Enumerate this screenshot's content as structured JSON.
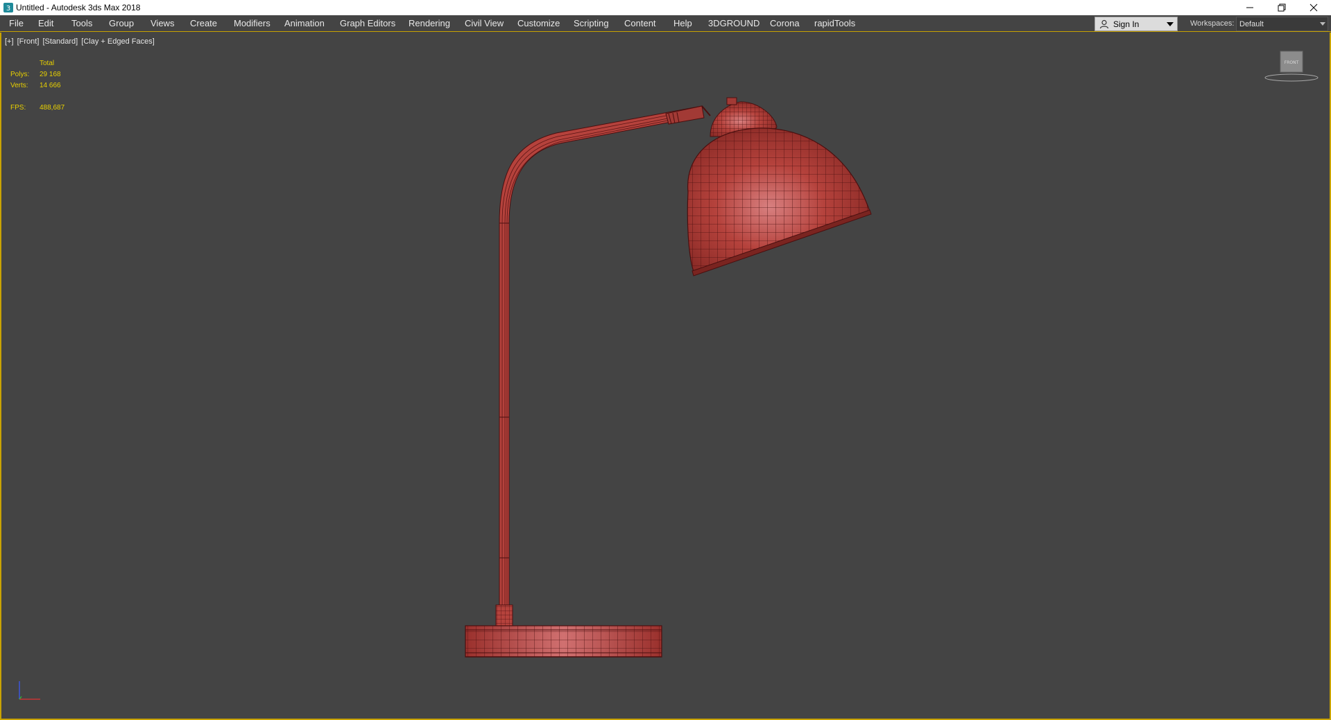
{
  "window": {
    "title": "Untitled - Autodesk 3ds Max 2018",
    "app_icon": "3dsmax-icon"
  },
  "menu": {
    "items": [
      {
        "label": "File"
      },
      {
        "label": "Edit"
      },
      {
        "label": "Tools"
      },
      {
        "label": "Group"
      },
      {
        "label": "Views"
      },
      {
        "label": "Create"
      },
      {
        "label": "Modifiers"
      },
      {
        "label": "Animation"
      },
      {
        "label": "Graph Editors"
      },
      {
        "label": "Rendering"
      },
      {
        "label": "Civil View"
      },
      {
        "label": "Customize"
      },
      {
        "label": "Scripting"
      },
      {
        "label": "Content"
      },
      {
        "label": "Help"
      },
      {
        "label": "3DGROUND"
      },
      {
        "label": "Corona"
      },
      {
        "label": "rapidTools"
      }
    ],
    "sign_in": "Sign In",
    "workspaces_label": "Workspaces:",
    "workspace_value": "Default"
  },
  "viewport": {
    "label_plus": "[+]",
    "label_view": "[Front]",
    "label_shading": "[Standard]",
    "label_mode": "[Clay + Edged Faces]",
    "stats": {
      "header": "Total",
      "polys_label": "Polys:",
      "polys_value": "29 168",
      "verts_label": "Verts:",
      "verts_value": "14 666",
      "fps_label": "FPS:",
      "fps_value": "488,687"
    },
    "viewcube_face": "FRONT",
    "model_color": "#b5423c",
    "wire_color": "#5a1414",
    "accent_border": "#c9a300"
  }
}
